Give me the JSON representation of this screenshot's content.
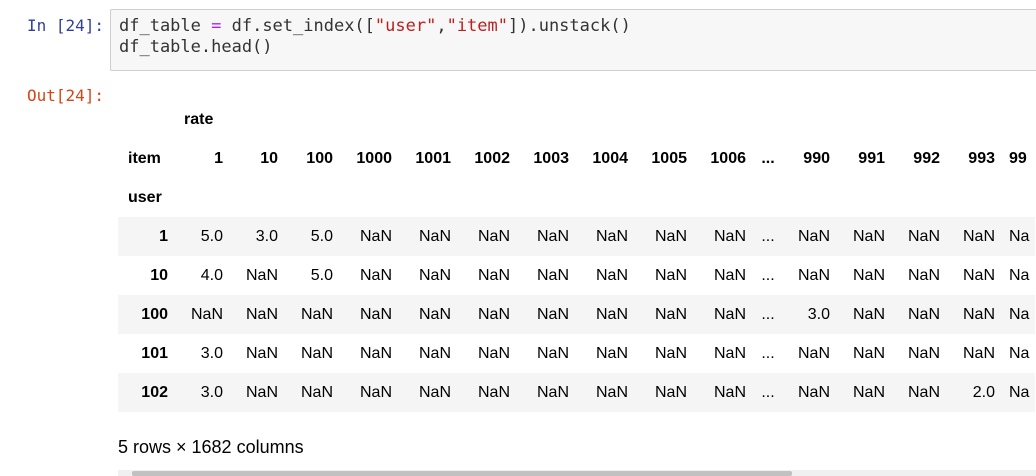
{
  "input_prompt": "In [24]:",
  "output_prompt": "Out[24]:",
  "code": {
    "line1": {
      "a": "df_table ",
      "eq": "=",
      "b": " df.set_index([",
      "s1": "\"user\"",
      "comma": ",",
      "s2": "\"item\"",
      "c": "]).unstack()"
    },
    "line2": "df_table.head()"
  },
  "table": {
    "top_header": "rate",
    "columns_name": "item",
    "index_name": "user",
    "columns": [
      "1",
      "10",
      "100",
      "1000",
      "1001",
      "1002",
      "1003",
      "1004",
      "1005",
      "1006",
      "...",
      "990",
      "991",
      "992",
      "993",
      "99"
    ],
    "rows": [
      {
        "index": "1",
        "values": [
          "5.0",
          "3.0",
          "5.0",
          "NaN",
          "NaN",
          "NaN",
          "NaN",
          "NaN",
          "NaN",
          "NaN",
          "...",
          "NaN",
          "NaN",
          "NaN",
          "NaN",
          "Na"
        ]
      },
      {
        "index": "10",
        "values": [
          "4.0",
          "NaN",
          "5.0",
          "NaN",
          "NaN",
          "NaN",
          "NaN",
          "NaN",
          "NaN",
          "NaN",
          "...",
          "NaN",
          "NaN",
          "NaN",
          "NaN",
          "Na"
        ]
      },
      {
        "index": "100",
        "values": [
          "NaN",
          "NaN",
          "NaN",
          "NaN",
          "NaN",
          "NaN",
          "NaN",
          "NaN",
          "NaN",
          "NaN",
          "...",
          "3.0",
          "NaN",
          "NaN",
          "NaN",
          "Na"
        ]
      },
      {
        "index": "101",
        "values": [
          "3.0",
          "NaN",
          "NaN",
          "NaN",
          "NaN",
          "NaN",
          "NaN",
          "NaN",
          "NaN",
          "NaN",
          "...",
          "NaN",
          "NaN",
          "NaN",
          "NaN",
          "Na"
        ]
      },
      {
        "index": "102",
        "values": [
          "3.0",
          "NaN",
          "NaN",
          "NaN",
          "NaN",
          "NaN",
          "NaN",
          "NaN",
          "NaN",
          "NaN",
          "...",
          "NaN",
          "NaN",
          "NaN",
          "2.0",
          "Na"
        ]
      }
    ]
  },
  "shape_text": "5 rows × 1682 columns"
}
